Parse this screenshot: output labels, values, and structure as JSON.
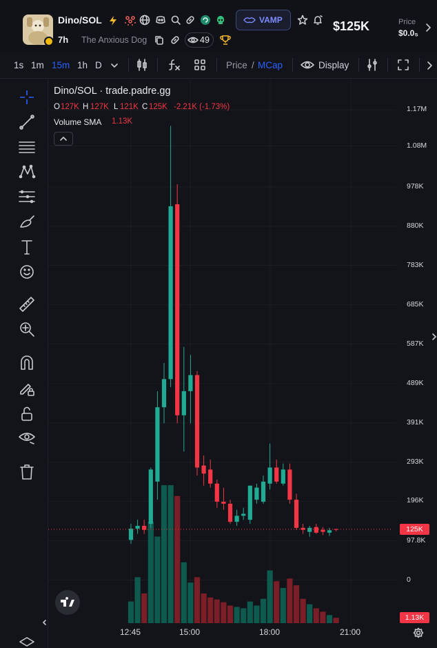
{
  "header": {
    "token_name": "Dino/SOL",
    "age": "7h",
    "description": "The Anxious Dog",
    "watchers": "49",
    "vamp_label": "VAMP",
    "market_cap": "$125K",
    "price_label": "Price",
    "price_value": "$0.0₅",
    "icons": [
      "lightning-icon",
      "holders-icon",
      "globe-icon",
      "discord-icon",
      "search-icon",
      "link-icon",
      "rank-icon",
      "skull-icon",
      "star-icon",
      "bell-icon",
      "chevron-right-icon",
      "copy-icon",
      "eye-icon",
      "trophy-icon"
    ]
  },
  "toolbar": {
    "intervals": [
      "1s",
      "1m",
      "15m",
      "1h",
      "D"
    ],
    "active_interval": "15m",
    "price_label": "Price",
    "slash": "/",
    "mcap_label": "MCap",
    "display_label": "Display",
    "accent": "#2962ff"
  },
  "left_tools": [
    "crosshair-icon",
    "trendline-icon",
    "fib-icon",
    "pattern-icon",
    "measure-lines-icon",
    "brush-icon",
    "text-icon",
    "emoji-icon",
    "ruler-icon",
    "zoom-in-icon",
    "magnet-icon",
    "lock-pencil-icon",
    "unlock-icon",
    "eye-icon",
    "trash-icon",
    "layers-icon"
  ],
  "chart_data": {
    "type": "candlestick",
    "title": "Dino/SOL · trade.padre.gg",
    "ohlc": {
      "o_label": "O",
      "o": "127K",
      "h_label": "H",
      "h": "127K",
      "l_label": "L",
      "l": "121K",
      "c_label": "C",
      "c": "125K",
      "change": "-2.21K (-1.73%)"
    },
    "volume_label": "Volume SMA",
    "volume_value": "1.13K",
    "y_ticks": [
      "1.17M",
      "1.08M",
      "978K",
      "880K",
      "783K",
      "685K",
      "587K",
      "489K",
      "391K",
      "293K",
      "196K",
      "97.8K",
      "0"
    ],
    "current_price": "125K",
    "current_volume": "1.13K",
    "x_ticks": [
      "12:45",
      "15:00",
      "18:00",
      "21:00"
    ],
    "colors": {
      "up": "#22ab94",
      "down": "#f23645",
      "up_vol": "#0e5a4e",
      "down_vol": "#7a1e28"
    },
    "candles": [
      {
        "o": 100,
        "h": 140,
        "l": 90,
        "c": 128,
        "v": 160
      },
      {
        "o": 128,
        "h": 150,
        "l": 115,
        "c": 135,
        "v": 340
      },
      {
        "o": 135,
        "h": 150,
        "l": 115,
        "c": 125,
        "v": 220
      },
      {
        "o": 140,
        "h": 280,
        "l": 130,
        "c": 275,
        "v": 750
      },
      {
        "o": 245,
        "h": 470,
        "l": 200,
        "c": 430,
        "v": 640
      },
      {
        "o": 430,
        "h": 540,
        "l": 390,
        "c": 500,
        "v": 1020
      },
      {
        "o": 500,
        "h": 1130,
        "l": 480,
        "c": 930,
        "v": 1020
      },
      {
        "o": 935,
        "h": 985,
        "l": 390,
        "c": 410,
        "v": 940
      },
      {
        "o": 410,
        "h": 580,
        "l": 320,
        "c": 470,
        "v": 450
      },
      {
        "o": 470,
        "h": 560,
        "l": 390,
        "c": 510,
        "v": 300
      },
      {
        "o": 510,
        "h": 520,
        "l": 260,
        "c": 280,
        "v": 340
      },
      {
        "o": 285,
        "h": 310,
        "l": 235,
        "c": 265,
        "v": 220
      },
      {
        "o": 275,
        "h": 300,
        "l": 230,
        "c": 240,
        "v": 190
      },
      {
        "o": 240,
        "h": 250,
        "l": 180,
        "c": 195,
        "v": 175
      },
      {
        "o": 195,
        "h": 230,
        "l": 175,
        "c": 190,
        "v": 155
      },
      {
        "o": 190,
        "h": 200,
        "l": 140,
        "c": 145,
        "v": 130
      },
      {
        "o": 145,
        "h": 175,
        "l": 135,
        "c": 160,
        "v": 120
      },
      {
        "o": 160,
        "h": 180,
        "l": 150,
        "c": 165,
        "v": 110
      },
      {
        "o": 150,
        "h": 230,
        "l": 140,
        "c": 235,
        "v": 160
      },
      {
        "o": 200,
        "h": 240,
        "l": 190,
        "c": 230,
        "v": 130
      },
      {
        "o": 195,
        "h": 260,
        "l": 190,
        "c": 245,
        "v": 180
      },
      {
        "o": 240,
        "h": 340,
        "l": 225,
        "c": 280,
        "v": 390
      },
      {
        "o": 280,
        "h": 300,
        "l": 240,
        "c": 245,
        "v": 310
      },
      {
        "o": 240,
        "h": 290,
        "l": 235,
        "c": 275,
        "v": 260
      },
      {
        "o": 275,
        "h": 290,
        "l": 190,
        "c": 200,
        "v": 330
      },
      {
        "o": 200,
        "h": 215,
        "l": 125,
        "c": 130,
        "v": 280
      },
      {
        "o": 130,
        "h": 140,
        "l": 115,
        "c": 125,
        "v": 180
      },
      {
        "o": 120,
        "h": 135,
        "l": 108,
        "c": 130,
        "v": 140
      },
      {
        "o": 132,
        "h": 140,
        "l": 115,
        "c": 118,
        "v": 110
      },
      {
        "o": 125,
        "h": 132,
        "l": 112,
        "c": 120,
        "v": 85
      },
      {
        "o": 118,
        "h": 130,
        "l": 110,
        "c": 124,
        "v": 60
      },
      {
        "o": 127,
        "h": 127,
        "l": 121,
        "c": 125,
        "v": 40
      }
    ]
  }
}
